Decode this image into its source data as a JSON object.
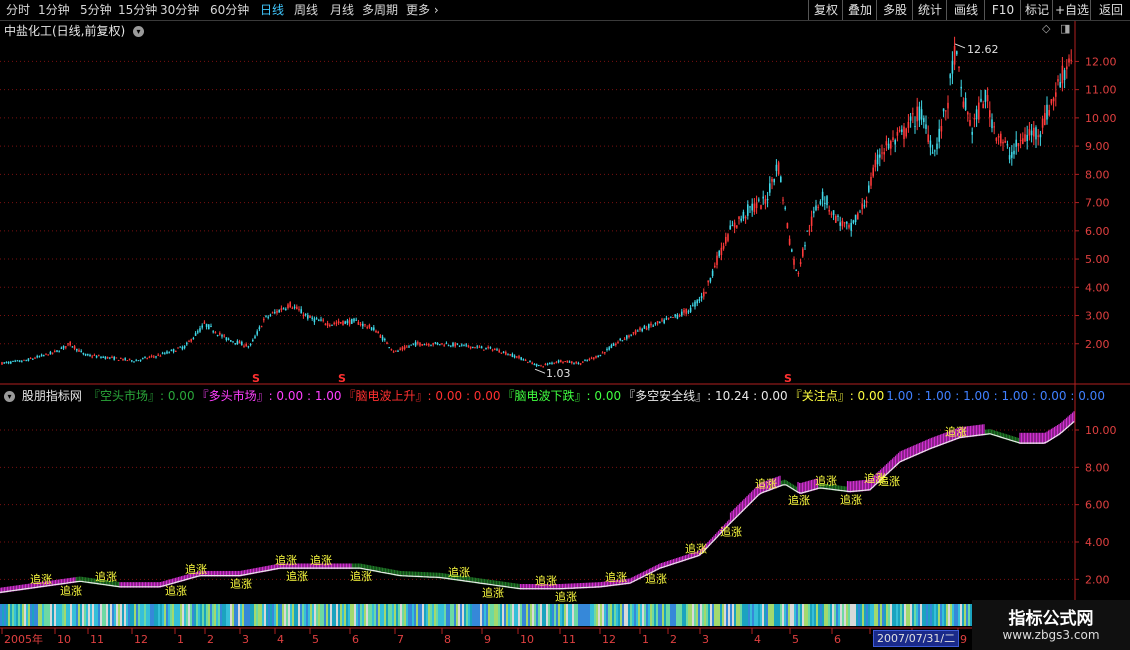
{
  "toolbar": {
    "periods": [
      "分时",
      "1分钟",
      "5分钟",
      "15分钟",
      "30分钟",
      "60分钟",
      "日线",
      "周线",
      "月线",
      "多周期",
      "更多"
    ],
    "active_period": "日线",
    "right_buttons": [
      "复权",
      "叠加",
      "多股",
      "统计",
      "画线",
      "F10",
      "标记",
      "+自选",
      "返回"
    ]
  },
  "main_panel": {
    "title": "中盐化工(日线,前复权)",
    "high_label": "12.62",
    "low_label": "1.03",
    "signal_marks": [
      "S",
      "S",
      "S"
    ]
  },
  "indicator_panel": {
    "name": "股朋指标网",
    "legend": [
      {
        "text": "『空头市场』: 0.00",
        "color": "#2aa83a"
      },
      {
        "text": "『多头市场』: 0.00 : 1.00",
        "color": "#ff40ff"
      },
      {
        "text": "『脑电波上升』: 0.00 : 0.00",
        "color": "#ff3030"
      },
      {
        "text": "『脑电波下跌』: 0.00",
        "color": "#40ff40"
      },
      {
        "text": "『多空安全线』: 10.24 : 0.00",
        "color": "#e8e8e8"
      },
      {
        "text": "『关注点』: 0.00",
        "color": "#ffff40"
      },
      {
        "text": "1.00 : 1.00 : 1.00 : 1.00 : 0.00 : 0.00",
        "color": "#4080ff"
      }
    ],
    "tag_label": "追涨"
  },
  "chart_data": [
    {
      "type": "candlestick",
      "title": "中盐化工(日线,前复权)",
      "y_ticks": [
        2.0,
        3.0,
        4.0,
        5.0,
        6.0,
        7.0,
        8.0,
        9.0,
        10.0,
        11.0,
        12.0
      ],
      "ylim": [
        1.0,
        12.9
      ],
      "annotations": [
        {
          "label": "12.62"
        },
        {
          "label": "1.03"
        }
      ],
      "x_tick_labels": [
        "2005年",
        "10",
        "11",
        "12",
        "1",
        "2",
        "3",
        "4",
        "5",
        "6",
        "7",
        "8",
        "9",
        "10",
        "11",
        "12",
        "1",
        "2",
        "3",
        "4",
        "5",
        "6",
        "7",
        "8",
        "9",
        "10"
      ],
      "price_path": [
        [
          0,
          1.3
        ],
        [
          25,
          1.4
        ],
        [
          55,
          1.7
        ],
        [
          70,
          2.0
        ],
        [
          85,
          1.6
        ],
        [
          110,
          1.5
        ],
        [
          135,
          1.4
        ],
        [
          160,
          1.6
        ],
        [
          185,
          1.9
        ],
        [
          205,
          2.7
        ],
        [
          225,
          2.2
        ],
        [
          250,
          1.9
        ],
        [
          265,
          2.9
        ],
        [
          290,
          3.4
        ],
        [
          310,
          2.9
        ],
        [
          330,
          2.7
        ],
        [
          355,
          2.8
        ],
        [
          375,
          2.5
        ],
        [
          395,
          1.7
        ],
        [
          415,
          2.0
        ],
        [
          445,
          2.0
        ],
        [
          470,
          1.9
        ],
        [
          495,
          1.8
        ],
        [
          520,
          1.5
        ],
        [
          540,
          1.2
        ],
        [
          560,
          1.4
        ],
        [
          580,
          1.3
        ],
        [
          600,
          1.6
        ],
        [
          620,
          2.1
        ],
        [
          640,
          2.5
        ],
        [
          665,
          2.8
        ],
        [
          690,
          3.2
        ],
        [
          705,
          3.8
        ],
        [
          715,
          4.8
        ],
        [
          730,
          6.0
        ],
        [
          750,
          6.8
        ],
        [
          765,
          7.0
        ],
        [
          778,
          8.4
        ],
        [
          790,
          5.6
        ],
        [
          797,
          4.4
        ],
        [
          808,
          6.0
        ],
        [
          822,
          7.3
        ],
        [
          835,
          6.5
        ],
        [
          850,
          6.0
        ],
        [
          865,
          7.0
        ],
        [
          880,
          8.8
        ],
        [
          900,
          9.3
        ],
        [
          920,
          10.2
        ],
        [
          935,
          8.8
        ],
        [
          948,
          10.6
        ],
        [
          955,
          12.4
        ],
        [
          962,
          10.8
        ],
        [
          972,
          9.6
        ],
        [
          985,
          10.8
        ],
        [
          995,
          9.6
        ],
        [
          1010,
          8.7
        ],
        [
          1025,
          9.3
        ],
        [
          1040,
          9.6
        ],
        [
          1055,
          10.8
        ],
        [
          1062,
          11.5
        ],
        [
          1072,
          12.3
        ]
      ]
    },
    {
      "type": "area",
      "series": [
        {
          "name": "『多空安全线』"
        }
      ],
      "y_ticks": [
        2.0,
        4.0,
        6.0,
        8.0,
        10.0
      ],
      "ylim": [
        1.0,
        11.5
      ],
      "path": [
        [
          0,
          1.3
        ],
        [
          40,
          1.6
        ],
        [
          80,
          1.9
        ],
        [
          120,
          1.6
        ],
        [
          160,
          1.6
        ],
        [
          200,
          2.2
        ],
        [
          240,
          2.2
        ],
        [
          280,
          2.6
        ],
        [
          320,
          2.6
        ],
        [
          360,
          2.6
        ],
        [
          400,
          2.2
        ],
        [
          440,
          2.1
        ],
        [
          480,
          1.8
        ],
        [
          520,
          1.5
        ],
        [
          560,
          1.5
        ],
        [
          600,
          1.6
        ],
        [
          630,
          1.8
        ],
        [
          660,
          2.6
        ],
        [
          700,
          3.3
        ],
        [
          730,
          5.0
        ],
        [
          760,
          6.6
        ],
        [
          785,
          7.1
        ],
        [
          800,
          6.6
        ],
        [
          820,
          6.9
        ],
        [
          850,
          6.7
        ],
        [
          870,
          6.8
        ],
        [
          900,
          8.3
        ],
        [
          930,
          9.0
        ],
        [
          960,
          9.6
        ],
        [
          990,
          9.8
        ],
        [
          1020,
          9.3
        ],
        [
          1045,
          9.3
        ],
        [
          1060,
          9.8
        ],
        [
          1075,
          10.5
        ]
      ],
      "tags_x": [
        40,
        70,
        105,
        175,
        195,
        240,
        285,
        296,
        320,
        360,
        458,
        492,
        545,
        565,
        615,
        655,
        695,
        730,
        765,
        798,
        825,
        850,
        874,
        888,
        955
      ]
    }
  ]
}
